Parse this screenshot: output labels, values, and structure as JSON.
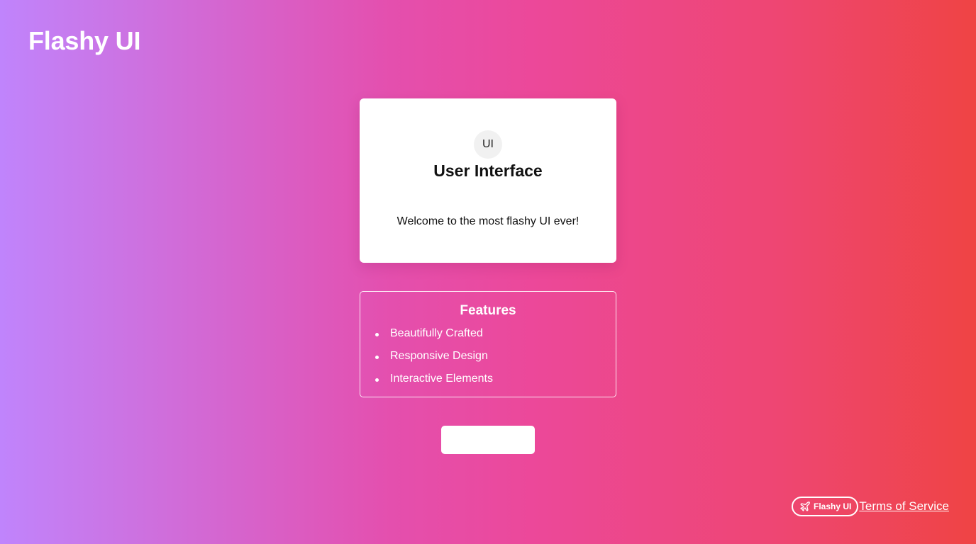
{
  "header": {
    "title": "Flashy UI"
  },
  "card": {
    "avatar_text": "UI",
    "title": "User Interface",
    "text": "Welcome to the most flashy UI ever!"
  },
  "features": {
    "title": "Features",
    "items": [
      "Beautifully Crafted",
      "Responsive Design",
      "Interactive Elements"
    ]
  },
  "action_button": {
    "label": ""
  },
  "footer": {
    "badge_label": "Flashy UI",
    "badge_icon": "plane-icon",
    "terms_label": "Terms of Service"
  },
  "colors": {
    "gradient_start": "#c084fc",
    "gradient_mid": "#ec4899",
    "gradient_end": "#ef4444",
    "card_background": "#ffffff"
  }
}
